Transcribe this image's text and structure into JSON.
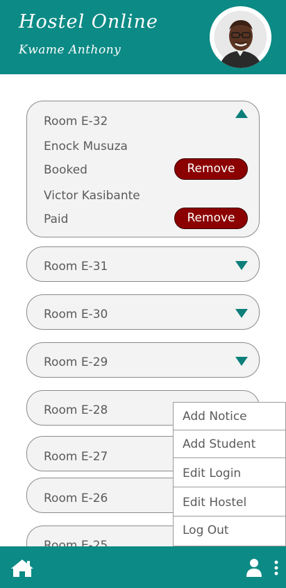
{
  "header": {
    "title": "Hostel Online",
    "user_name": "Kwame Anthony"
  },
  "rooms": [
    {
      "name": "Room E-32",
      "expanded": true,
      "occupants": [
        {
          "name": "Enock Musuza",
          "status": "Booked",
          "action": "Remove"
        },
        {
          "name": "Victor Kasibante",
          "status": "Paid",
          "action": "Remove"
        }
      ]
    },
    {
      "name": "Room E-31",
      "expanded": false
    },
    {
      "name": "Room E-30",
      "expanded": false
    },
    {
      "name": "Room E-29",
      "expanded": false
    },
    {
      "name": "Room E-28",
      "expanded": false
    },
    {
      "name": "Room E-27",
      "expanded": false
    },
    {
      "name": "Room E-26",
      "expanded": false
    },
    {
      "name": "Room E-25",
      "expanded": false
    }
  ],
  "menu": {
    "items": [
      "Add Notice",
      "Add Student",
      "Edit Login",
      "Edit Hostel",
      "Log Out"
    ]
  },
  "bottom_bar": {
    "icons": [
      "home-icon",
      "person-icon",
      "more-vert-icon"
    ]
  },
  "colors": {
    "primary": "#0c8a85",
    "remove": "#8b0000",
    "card_bg": "#f3f3f3"
  }
}
